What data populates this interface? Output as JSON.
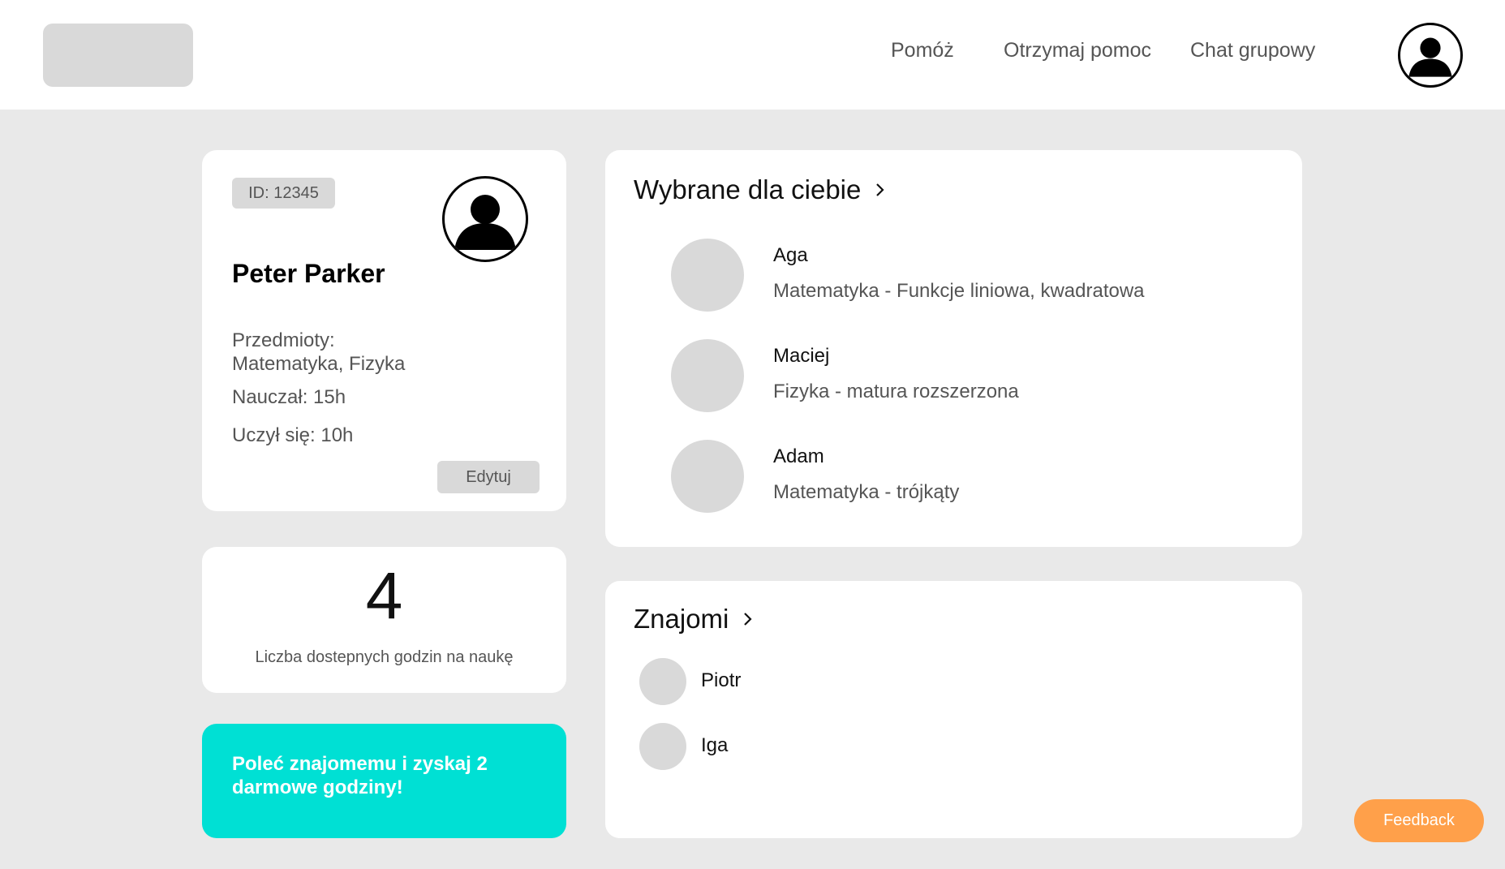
{
  "header": {
    "nav": {
      "help": "Pomóż",
      "get_help": "Otrzymaj pomoc",
      "group_chat": "Chat grupowy"
    },
    "avatar_icon": "user-avatar-icon"
  },
  "profile": {
    "id_label": "ID: 12345",
    "name": "Peter Parker",
    "subjects_label": "Przedmioty:",
    "subjects_value": "Matematyka, Fizyka",
    "taught": "Nauczał: 15h",
    "learned": "Uczył się: 10h",
    "edit_label": "Edytuj",
    "avatar_icon": "user-avatar-icon"
  },
  "hours": {
    "value": "4",
    "label": "Liczba dostepnych godzin na naukę"
  },
  "promo": {
    "text": "Poleć znajomemu i zyskaj 2 darmowe godziny!"
  },
  "recommended": {
    "title": "Wybrane dla ciebie",
    "items": [
      {
        "name": "Aga",
        "topic": "Matematyka - Funkcje liniowa, kwadratowa"
      },
      {
        "name": "Maciej",
        "topic": "Fizyka - matura rozszerzona"
      },
      {
        "name": "Adam",
        "topic": "Matematyka - trójkąty"
      }
    ]
  },
  "friends": {
    "title": "Znajomi",
    "items": [
      {
        "name": "Piotr"
      },
      {
        "name": "Iga"
      }
    ]
  },
  "feedback": {
    "label": "Feedback"
  },
  "colors": {
    "background": "#e9e9e9",
    "card": "#ffffff",
    "placeholder": "#d9d9d9",
    "promo": "#00e0d4",
    "feedback": "#ffa04a"
  }
}
